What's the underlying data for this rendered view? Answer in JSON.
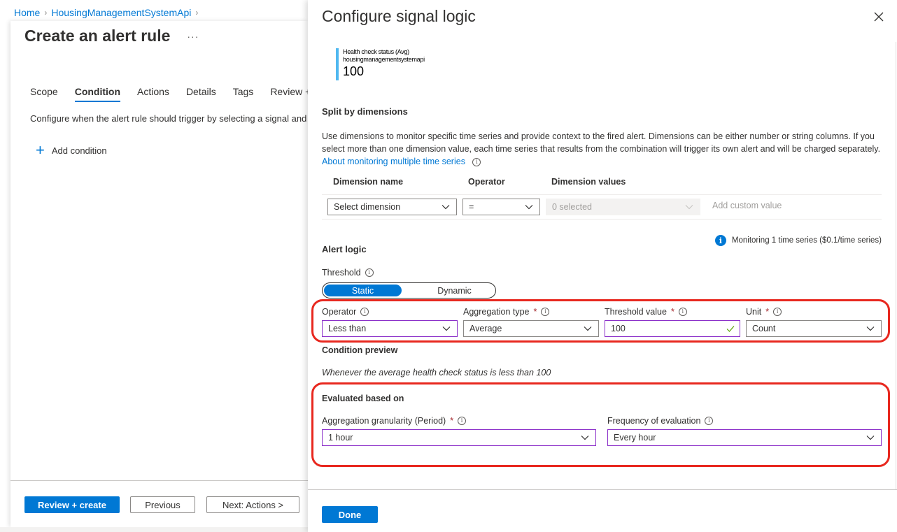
{
  "breadcrumb": {
    "items": [
      "Home",
      "HousingManagementSystemApi"
    ]
  },
  "blade": {
    "title": "Create an alert rule",
    "more_label": "···",
    "tabs": [
      {
        "label": "Scope",
        "active": false
      },
      {
        "label": "Condition",
        "active": true
      },
      {
        "label": "Actions",
        "active": false
      },
      {
        "label": "Details",
        "active": false
      },
      {
        "label": "Tags",
        "active": false
      },
      {
        "label": "Review +",
        "active": false
      }
    ],
    "description": "Configure when the alert rule should trigger by selecting a signal and",
    "add_condition_label": "Add condition",
    "footer": {
      "review_create": "Review + create",
      "previous": "Previous",
      "next": "Next: Actions >"
    }
  },
  "panel": {
    "title": "Configure signal logic",
    "close_icon": "close-icon",
    "signal": {
      "name": "Health check status (Avg)",
      "resource": "housingmanagementsystemapi",
      "value": "100",
      "color": "#4fb8f0"
    },
    "split": {
      "heading": "Split by dimensions",
      "paragraph": "Use dimensions to monitor specific time series and provide context to the fired alert. Dimensions can be either number or string columns. If you select more than one dimension value, each time series that results from the combination will trigger its own alert and will be charged separately.",
      "link": "About monitoring multiple time series",
      "columns": [
        "Dimension name",
        "Operator",
        "Dimension values"
      ],
      "row": {
        "dimension": "Select dimension",
        "operator": "=",
        "values": "0 selected",
        "custom_placeholder": "Add custom value"
      }
    },
    "monitoring_note": "Monitoring 1 time series ($0.1/time series)",
    "alert_logic": {
      "heading": "Alert logic",
      "threshold_label": "Threshold",
      "threshold_options": [
        "Static",
        "Dynamic"
      ],
      "threshold_selected": "Static",
      "operator": {
        "label": "Operator",
        "value": "Less than",
        "required": false
      },
      "aggregation_type": {
        "label": "Aggregation type",
        "value": "Average",
        "required": true
      },
      "threshold_value": {
        "label": "Threshold value",
        "value": "100",
        "required": true,
        "valid": true
      },
      "unit": {
        "label": "Unit",
        "value": "Count",
        "required": true
      },
      "required_mark": "*"
    },
    "condition_preview": {
      "heading": "Condition preview",
      "text": "Whenever the average health check status is less than 100"
    },
    "evaluated": {
      "heading": "Evaluated based on",
      "granularity": {
        "label": "Aggregation granularity (Period)",
        "value": "1 hour",
        "required": true
      },
      "frequency": {
        "label": "Frequency of evaluation",
        "value": "Every hour",
        "required": false
      }
    },
    "done_label": "Done"
  },
  "colors": {
    "accent": "#0078d4",
    "highlight_box": "#e8281f",
    "focus_border": "#8b2fc9",
    "required": "#a4262c",
    "valid_check": "#57a300"
  }
}
